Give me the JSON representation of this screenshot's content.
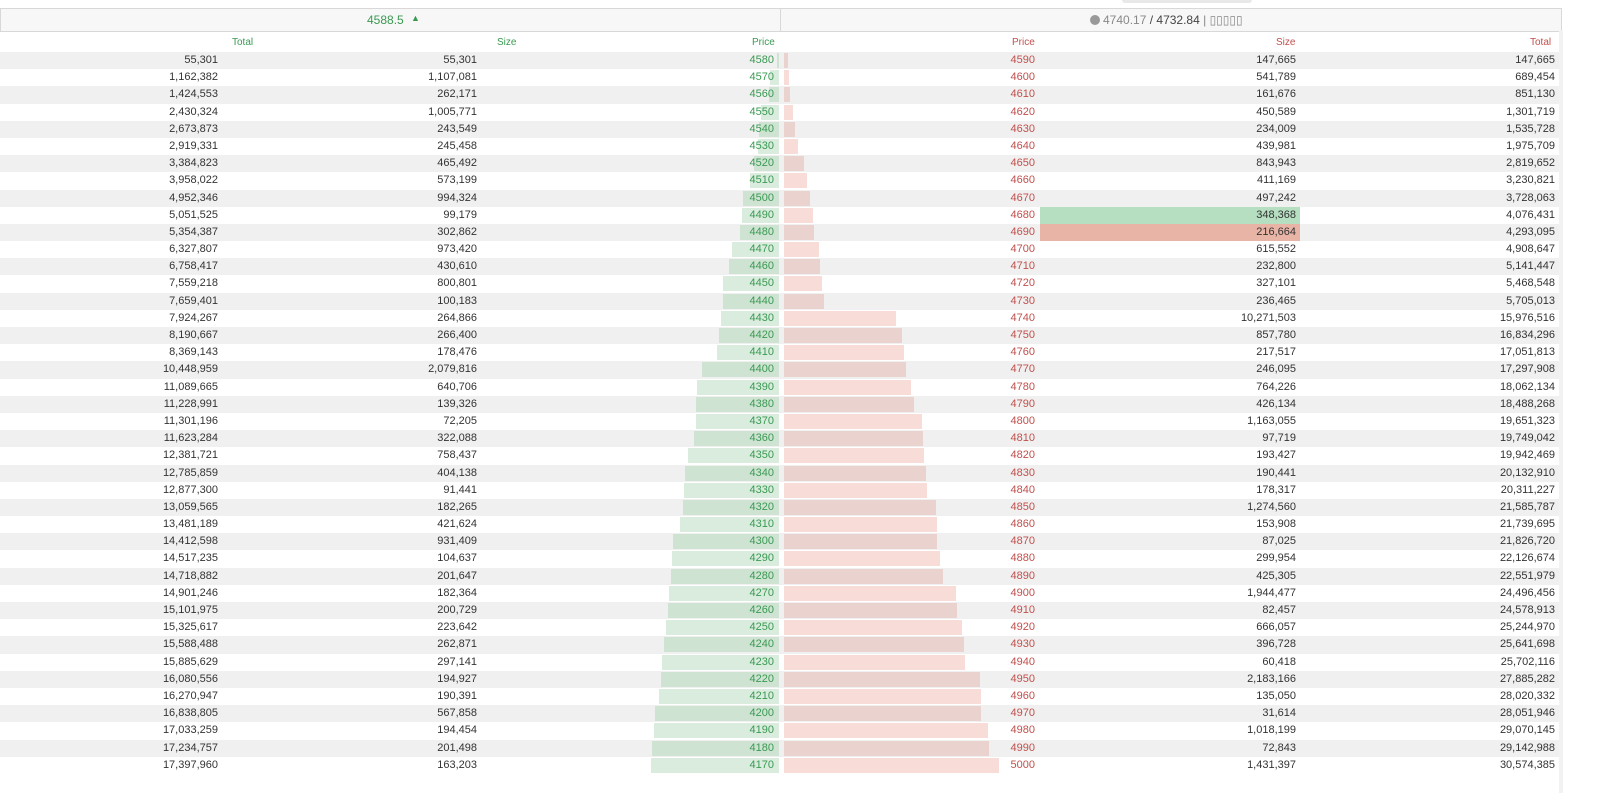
{
  "header": {
    "last_price": "4588.5",
    "direction_icon": "▲",
    "index_prices": "4740.17",
    "separator": " / ",
    "mark_price": "4732.84",
    "suffix": " | ▯▯▯▯▯"
  },
  "columns": {
    "bid_total": "Total",
    "bid_size": "Size",
    "bid_price": "Price",
    "ask_price": "Price",
    "ask_size": "Size",
    "ask_total": "Total"
  },
  "colors": {
    "bid": "#3a9a52",
    "ask": "#c0504d",
    "highlight_green": "#b5dfc0",
    "highlight_red": "#e8b4a6"
  },
  "highlights": {
    "green_row": 9,
    "red_row": 10,
    "underline_row": 15
  },
  "rows": [
    {
      "bt": "55,301",
      "bs": "55,301",
      "bp": "4580",
      "ap": "4590",
      "as": "147,665",
      "at": "147,665"
    },
    {
      "bt": "1,162,382",
      "bs": "1,107,081",
      "bp": "4570",
      "ap": "4600",
      "as": "541,789",
      "at": "689,454"
    },
    {
      "bt": "1,424,553",
      "bs": "262,171",
      "bp": "4560",
      "ap": "4610",
      "as": "161,676",
      "at": "851,130"
    },
    {
      "bt": "2,430,324",
      "bs": "1,005,771",
      "bp": "4550",
      "ap": "4620",
      "as": "450,589",
      "at": "1,301,719"
    },
    {
      "bt": "2,673,873",
      "bs": "243,549",
      "bp": "4540",
      "ap": "4630",
      "as": "234,009",
      "at": "1,535,728"
    },
    {
      "bt": "2,919,331",
      "bs": "245,458",
      "bp": "4530",
      "ap": "4640",
      "as": "439,981",
      "at": "1,975,709"
    },
    {
      "bt": "3,384,823",
      "bs": "465,492",
      "bp": "4520",
      "ap": "4650",
      "as": "843,943",
      "at": "2,819,652"
    },
    {
      "bt": "3,958,022",
      "bs": "573,199",
      "bp": "4510",
      "ap": "4660",
      "as": "411,169",
      "at": "3,230,821"
    },
    {
      "bt": "4,952,346",
      "bs": "994,324",
      "bp": "4500",
      "ap": "4670",
      "as": "497,242",
      "at": "3,728,063"
    },
    {
      "bt": "5,051,525",
      "bs": "99,179",
      "bp": "4490",
      "ap": "4680",
      "as": "348,368",
      "at": "4,076,431"
    },
    {
      "bt": "5,354,387",
      "bs": "302,862",
      "bp": "4480",
      "ap": "4690",
      "as": "216,664",
      "at": "4,293,095"
    },
    {
      "bt": "6,327,807",
      "bs": "973,420",
      "bp": "4470",
      "ap": "4700",
      "as": "615,552",
      "at": "4,908,647"
    },
    {
      "bt": "6,758,417",
      "bs": "430,610",
      "bp": "4460",
      "ap": "4710",
      "as": "232,800",
      "at": "5,141,447"
    },
    {
      "bt": "7,559,218",
      "bs": "800,801",
      "bp": "4450",
      "ap": "4720",
      "as": "327,101",
      "at": "5,468,548"
    },
    {
      "bt": "7,659,401",
      "bs": "100,183",
      "bp": "4440",
      "ap": "4730",
      "as": "236,465",
      "at": "5,705,013"
    },
    {
      "bt": "7,924,267",
      "bs": "264,866",
      "bp": "4430",
      "ap": "4740",
      "as": "10,271,503",
      "at": "15,976,516"
    },
    {
      "bt": "8,190,667",
      "bs": "266,400",
      "bp": "4420",
      "ap": "4750",
      "as": "857,780",
      "at": "16,834,296"
    },
    {
      "bt": "8,369,143",
      "bs": "178,476",
      "bp": "4410",
      "ap": "4760",
      "as": "217,517",
      "at": "17,051,813"
    },
    {
      "bt": "10,448,959",
      "bs": "2,079,816",
      "bp": "4400",
      "ap": "4770",
      "as": "246,095",
      "at": "17,297,908"
    },
    {
      "bt": "11,089,665",
      "bs": "640,706",
      "bp": "4390",
      "ap": "4780",
      "as": "764,226",
      "at": "18,062,134"
    },
    {
      "bt": "11,228,991",
      "bs": "139,326",
      "bp": "4380",
      "ap": "4790",
      "as": "426,134",
      "at": "18,488,268"
    },
    {
      "bt": "11,301,196",
      "bs": "72,205",
      "bp": "4370",
      "ap": "4800",
      "as": "1,163,055",
      "at": "19,651,323"
    },
    {
      "bt": "11,623,284",
      "bs": "322,088",
      "bp": "4360",
      "ap": "4810",
      "as": "97,719",
      "at": "19,749,042"
    },
    {
      "bt": "12,381,721",
      "bs": "758,437",
      "bp": "4350",
      "ap": "4820",
      "as": "193,427",
      "at": "19,942,469"
    },
    {
      "bt": "12,785,859",
      "bs": "404,138",
      "bp": "4340",
      "ap": "4830",
      "as": "190,441",
      "at": "20,132,910"
    },
    {
      "bt": "12,877,300",
      "bs": "91,441",
      "bp": "4330",
      "ap": "4840",
      "as": "178,317",
      "at": "20,311,227"
    },
    {
      "bt": "13,059,565",
      "bs": "182,265",
      "bp": "4320",
      "ap": "4850",
      "as": "1,274,560",
      "at": "21,585,787"
    },
    {
      "bt": "13,481,189",
      "bs": "421,624",
      "bp": "4310",
      "ap": "4860",
      "as": "153,908",
      "at": "21,739,695"
    },
    {
      "bt": "14,412,598",
      "bs": "931,409",
      "bp": "4300",
      "ap": "4870",
      "as": "87,025",
      "at": "21,826,720"
    },
    {
      "bt": "14,517,235",
      "bs": "104,637",
      "bp": "4290",
      "ap": "4880",
      "as": "299,954",
      "at": "22,126,674"
    },
    {
      "bt": "14,718,882",
      "bs": "201,647",
      "bp": "4280",
      "ap": "4890",
      "as": "425,305",
      "at": "22,551,979"
    },
    {
      "bt": "14,901,246",
      "bs": "182,364",
      "bp": "4270",
      "ap": "4900",
      "as": "1,944,477",
      "at": "24,496,456"
    },
    {
      "bt": "15,101,975",
      "bs": "200,729",
      "bp": "4260",
      "ap": "4910",
      "as": "82,457",
      "at": "24,578,913"
    },
    {
      "bt": "15,325,617",
      "bs": "223,642",
      "bp": "4250",
      "ap": "4920",
      "as": "666,057",
      "at": "25,244,970"
    },
    {
      "bt": "15,588,488",
      "bs": "262,871",
      "bp": "4240",
      "ap": "4930",
      "as": "396,728",
      "at": "25,641,698"
    },
    {
      "bt": "15,885,629",
      "bs": "297,141",
      "bp": "4230",
      "ap": "4940",
      "as": "60,418",
      "at": "25,702,116"
    },
    {
      "bt": "16,080,556",
      "bs": "194,927",
      "bp": "4220",
      "ap": "4950",
      "as": "2,183,166",
      "at": "27,885,282"
    },
    {
      "bt": "16,270,947",
      "bs": "190,391",
      "bp": "4210",
      "ap": "4960",
      "as": "135,050",
      "at": "28,020,332"
    },
    {
      "bt": "16,838,805",
      "bs": "567,858",
      "bp": "4200",
      "ap": "4970",
      "as": "31,614",
      "at": "28,051,946"
    },
    {
      "bt": "17,033,259",
      "bs": "194,454",
      "bp": "4190",
      "ap": "4980",
      "as": "1,018,199",
      "at": "29,070,145"
    },
    {
      "bt": "17,234,757",
      "bs": "201,498",
      "bp": "4180",
      "ap": "4990",
      "as": "72,843",
      "at": "29,142,988"
    },
    {
      "bt": "17,397,960",
      "bs": "163,203",
      "bp": "4170",
      "ap": "5000",
      "as": "1,431,397",
      "at": "30,574,385"
    }
  ]
}
